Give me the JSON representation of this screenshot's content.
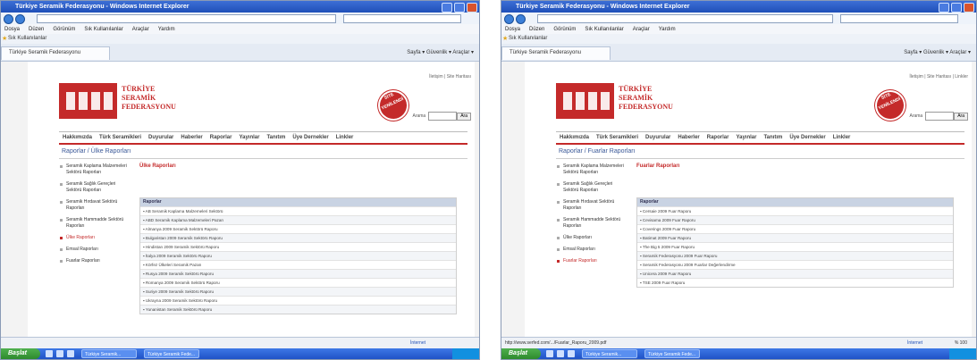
{
  "left": {
    "window_title": "Türkiye Seramik Federasyonu - Windows Internet Explorer",
    "menu": [
      "Dosya",
      "Düzen",
      "Görünüm",
      "Sık Kullanılanlar",
      "Araçlar",
      "Yardım"
    ],
    "favorites_label": "Sık Kullanılanlar",
    "tab_title": "Türkiye Seramik Federasyonu",
    "toolbar_tools": "Sayfa ▾  Güvenlik ▾  Araçlar ▾",
    "top_links": "İletişim  |  Site Haritası",
    "brand_lines": [
      "TÜRKİYE",
      "SERAMİK",
      "FEDERASYONU"
    ],
    "seal_lines": [
      "SİTE",
      "YENİLENDİ"
    ],
    "search_label": "Arama",
    "search_button": "Ara",
    "nav": [
      "Hakkımızda",
      "Türk Seramikleri",
      "Duyurular",
      "Haberler",
      "Raporlar",
      "Yayınlar",
      "Tanıtım",
      "Üye Dernekler",
      "Linkler"
    ],
    "breadcrumb": "Raporlar / Ülke Raporları",
    "sidebar": [
      "Seramik Kaplama Malzemeleri Sektörü Raporları",
      "Seramik Sağlık Gereçleri Sektörü Raporları",
      "Seramik Hırdavat Sektörü Raporları",
      "Seramik Hammadde Sektörü Raporları",
      "Ülke Raporları",
      "Emsal Raporları",
      "Fuarlar Raporları"
    ],
    "sidebar_active": 4,
    "content_title": "Ülke Raporları",
    "table_header": "Raporlar",
    "rows": [
      "AB Seramik Kaplama Malzemeleri Sektörü",
      "ABD Seramik Kaplama Malzemeleri Pazarı",
      "Almanya 2009 Seramik Sektörü Raporu",
      "Bulgaristan 2009 Seramik Sektörü Raporu",
      "Hindistan 2009 Seramik Sektörü Raporu",
      "İtalya 2009 Seramik Sektörü Raporu",
      "Körfez Ülkeleri Seramik Pazarı",
      "Rusya 2009 Seramik Sektörü Raporu",
      "Romanya 2009 Seramik Sektörü Raporu",
      "Suriye 2009 Seramik Sektörü Raporu",
      "Ukrayna 2009 Seramik Sektörü Raporu",
      "Yunanistan Seramik Sektörü Raporu"
    ],
    "status_zone": "İnternet",
    "start_label": "Başlat",
    "tasks": [
      "Türkiye Seramik...",
      "Türkiye Seramik Fede..."
    ]
  },
  "right": {
    "window_title": "Türkiye Seramik Federasyonu - Windows Internet Explorer",
    "menu": [
      "Dosya",
      "Düzen",
      "Görünüm",
      "Sık Kullanılanlar",
      "Araçlar",
      "Yardım"
    ],
    "favorites_label": "Sık Kullanılanlar",
    "tab_title": "Türkiye Seramik Federasyonu",
    "toolbar_tools": "Sayfa ▾  Güvenlik ▾  Araçlar ▾",
    "top_links": "İletişim  |  Site Haritası  |  Linkler",
    "brand_lines": [
      "TÜRKİYE",
      "SERAMİK",
      "FEDERASYONU"
    ],
    "seal_lines": [
      "SİTE",
      "YENİLENDİ"
    ],
    "search_label": "Arama",
    "search_button": "Ara",
    "nav": [
      "Hakkımızda",
      "Türk Seramikleri",
      "Duyurular",
      "Haberler",
      "Raporlar",
      "Yayınlar",
      "Tanıtım",
      "Üye Dernekler",
      "Linkler"
    ],
    "breadcrumb": "Raporlar / Fuarlar Raporları",
    "sidebar": [
      "Seramik Kaplama Malzemeleri Sektörü Raporları",
      "Seramik Sağlık Gereçleri Sektörü Raporları",
      "Seramik Hırdavat Sektörü Raporları",
      "Seramik Hammadde Sektörü Raporları",
      "Ülke Raporları",
      "Emsal Raporları",
      "Fuarlar Raporları"
    ],
    "sidebar_active": 6,
    "content_title": "Fuarlar Raporları",
    "table_header": "Raporlar",
    "rows": [
      "Cersaie 2009 Fuar Raporu",
      "Cevisama 2009 Fuar Raporu",
      "Coverings 2009 Fuar Raporu",
      "Batimat 2009 Fuar Raporu",
      "The Big 5 2009 Fuar Raporu",
      "Seramik Federasyonu 2009 Fuar Raporu",
      "Seramik Federasyonu 2009 Fuarlar Değerlendirme",
      "Unicera 2009 Fuar Raporu",
      "TSE 2009 Fuar Raporu"
    ],
    "status_url": "http://www.serfed.com/.../Fuarlar_Raporu_2009.pdf",
    "status_zone": "İnternet",
    "zoom": "% 100",
    "start_label": "Başlat",
    "tasks": [
      "Türkiye Seramik...",
      "Türkiye Seramik Fede..."
    ]
  }
}
